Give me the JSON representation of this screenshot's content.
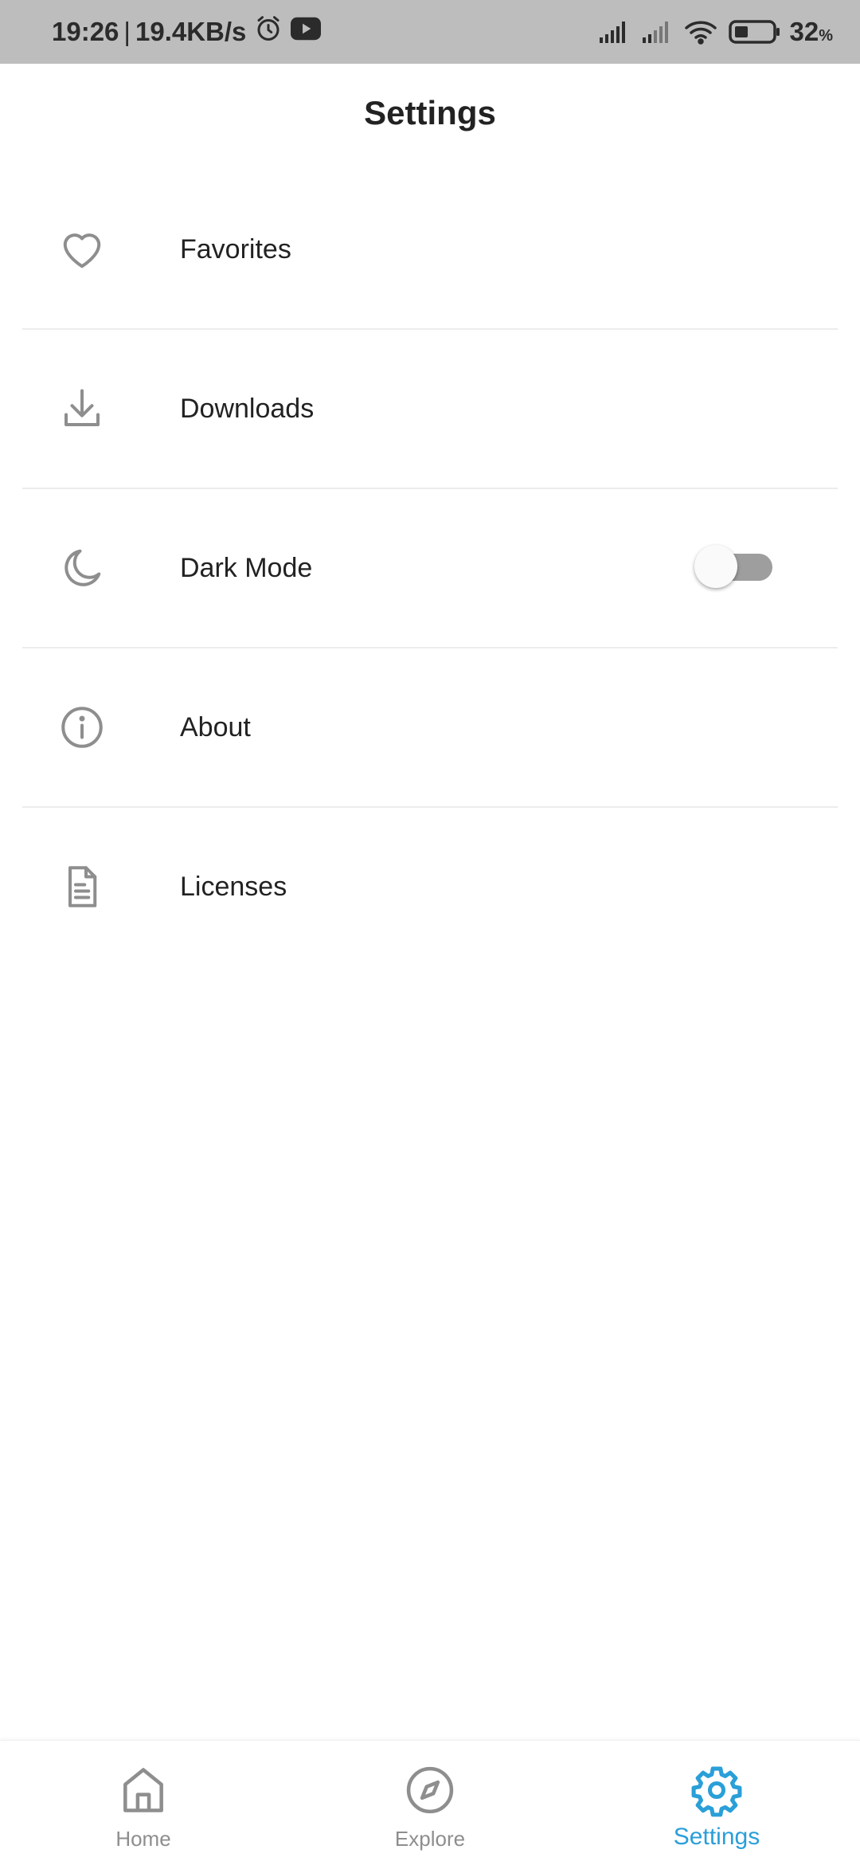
{
  "status_bar": {
    "time": "19:26",
    "separator": "|",
    "network_speed": "19.4KB/s",
    "battery_percent": "32",
    "battery_unit": "%",
    "icons": [
      "alarm-icon",
      "youtube-icon",
      "signal-icon",
      "signal-icon",
      "wifi-icon",
      "battery-icon"
    ]
  },
  "header": {
    "title": "Settings"
  },
  "settings": {
    "items": [
      {
        "label": "Favorites",
        "icon": "heart-icon"
      },
      {
        "label": "Downloads",
        "icon": "download-icon"
      },
      {
        "label": "Dark Mode",
        "icon": "moon-icon",
        "toggle": false
      },
      {
        "label": "About",
        "icon": "info-icon"
      },
      {
        "label": "Licenses",
        "icon": "document-icon"
      }
    ]
  },
  "bottom_nav": {
    "items": [
      {
        "label": "Home",
        "icon": "home-icon",
        "active": false
      },
      {
        "label": "Explore",
        "icon": "compass-icon",
        "active": false
      },
      {
        "label": "Settings",
        "icon": "gear-icon",
        "active": true
      }
    ]
  },
  "colors": {
    "accent": "#2a9fd8",
    "icon_gray": "#8e8e8e",
    "status_bar_bg": "#bdbdbd",
    "divider": "#ececec",
    "toggle_track": "#9e9e9e"
  }
}
